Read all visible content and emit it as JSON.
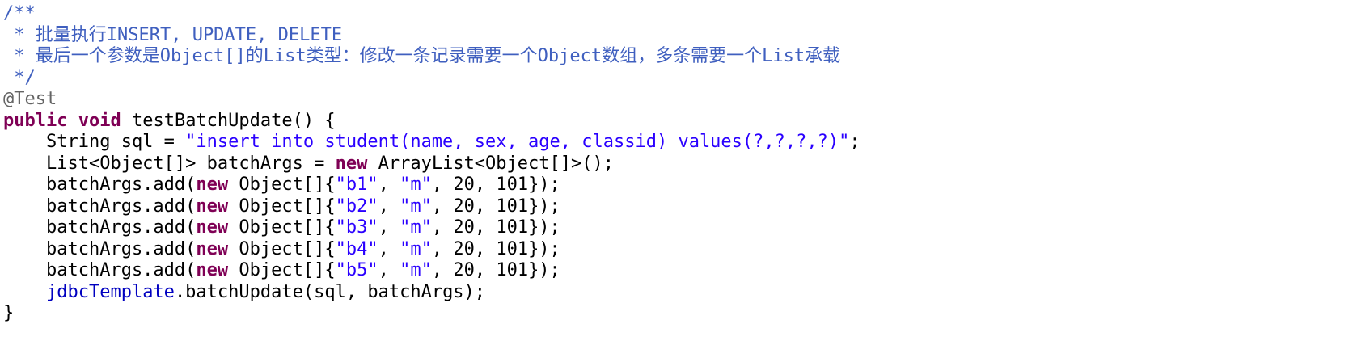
{
  "editor": {
    "colors": {
      "comment": "#3f5fbf",
      "annotation": "#646464",
      "keyword": "#7f0055",
      "string": "#2a00ff",
      "field": "#0000c0",
      "plain": "#000000",
      "background": "#ffffff"
    },
    "lines": [
      {
        "tokens": [
          {
            "type": "comment",
            "text": "/**"
          }
        ]
      },
      {
        "tokens": [
          {
            "type": "comment",
            "text": " * 批量执行INSERT, UPDATE, DELETE"
          }
        ]
      },
      {
        "tokens": [
          {
            "type": "comment",
            "text": " * 最后一个参数是Object[]的List类型：修改一条记录需要一个Object数组，多条需要一个List承载"
          }
        ]
      },
      {
        "tokens": [
          {
            "type": "comment",
            "text": " */"
          }
        ]
      },
      {
        "tokens": [
          {
            "type": "annotation",
            "text": "@Test"
          }
        ]
      },
      {
        "tokens": [
          {
            "type": "keyword",
            "text": "public"
          },
          {
            "type": "plain",
            "text": " "
          },
          {
            "type": "keyword",
            "text": "void"
          },
          {
            "type": "plain",
            "text": " testBatchUpdate() {"
          }
        ]
      },
      {
        "tokens": [
          {
            "type": "plain",
            "text": "    String sql = "
          },
          {
            "type": "string",
            "text": "\"insert into student(name, sex, age, classid) values(?,?,?,?)\""
          },
          {
            "type": "plain",
            "text": ";"
          }
        ]
      },
      {
        "tokens": [
          {
            "type": "plain",
            "text": "    List<Object[]> batchArgs = "
          },
          {
            "type": "keyword",
            "text": "new"
          },
          {
            "type": "plain",
            "text": " ArrayList<Object[]>();"
          }
        ]
      },
      {
        "tokens": [
          {
            "type": "plain",
            "text": "    batchArgs.add("
          },
          {
            "type": "keyword",
            "text": "new"
          },
          {
            "type": "plain",
            "text": " Object[]{"
          },
          {
            "type": "string",
            "text": "\"b1\""
          },
          {
            "type": "plain",
            "text": ", "
          },
          {
            "type": "string",
            "text": "\"m\""
          },
          {
            "type": "plain",
            "text": ", 20, 101});"
          }
        ]
      },
      {
        "tokens": [
          {
            "type": "plain",
            "text": "    batchArgs.add("
          },
          {
            "type": "keyword",
            "text": "new"
          },
          {
            "type": "plain",
            "text": " Object[]{"
          },
          {
            "type": "string",
            "text": "\"b2\""
          },
          {
            "type": "plain",
            "text": ", "
          },
          {
            "type": "string",
            "text": "\"m\""
          },
          {
            "type": "plain",
            "text": ", 20, 101});"
          }
        ]
      },
      {
        "tokens": [
          {
            "type": "plain",
            "text": "    batchArgs.add("
          },
          {
            "type": "keyword",
            "text": "new"
          },
          {
            "type": "plain",
            "text": " Object[]{"
          },
          {
            "type": "string",
            "text": "\"b3\""
          },
          {
            "type": "plain",
            "text": ", "
          },
          {
            "type": "string",
            "text": "\"m\""
          },
          {
            "type": "plain",
            "text": ", 20, 101});"
          }
        ]
      },
      {
        "tokens": [
          {
            "type": "plain",
            "text": "    batchArgs.add("
          },
          {
            "type": "keyword",
            "text": "new"
          },
          {
            "type": "plain",
            "text": " Object[]{"
          },
          {
            "type": "string",
            "text": "\"b4\""
          },
          {
            "type": "plain",
            "text": ", "
          },
          {
            "type": "string",
            "text": "\"m\""
          },
          {
            "type": "plain",
            "text": ", 20, 101});"
          }
        ]
      },
      {
        "tokens": [
          {
            "type": "plain",
            "text": "    batchArgs.add("
          },
          {
            "type": "keyword",
            "text": "new"
          },
          {
            "type": "plain",
            "text": " Object[]{"
          },
          {
            "type": "string",
            "text": "\"b5\""
          },
          {
            "type": "plain",
            "text": ", "
          },
          {
            "type": "string",
            "text": "\"m\""
          },
          {
            "type": "plain",
            "text": ", 20, 101});"
          }
        ]
      },
      {
        "tokens": [
          {
            "type": "plain",
            "text": "    "
          },
          {
            "type": "field",
            "text": "jdbcTemplate"
          },
          {
            "type": "plain",
            "text": ".batchUpdate(sql, batchArgs);"
          }
        ]
      },
      {
        "tokens": [
          {
            "type": "plain",
            "text": "}"
          }
        ]
      }
    ]
  }
}
